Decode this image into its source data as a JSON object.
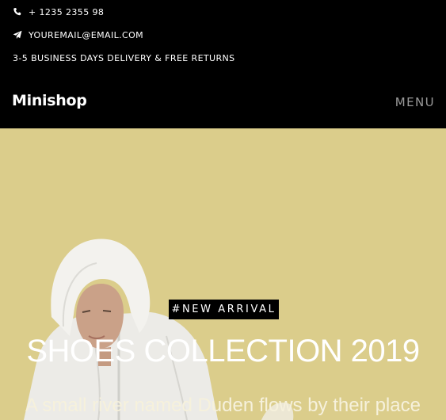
{
  "topbar": {
    "phone": "+ 1235 2355 98",
    "email": "YOUREMAIL@EMAIL.COM",
    "delivery": "3-5 BUSINESS DAYS DELIVERY & FREE RETURNS",
    "icons": {
      "phone": "phone-icon",
      "email": "paper-plane-icon"
    }
  },
  "navbar": {
    "brand": "Minishop",
    "menu_label": "MENU"
  },
  "hero": {
    "badge": "#NEW ARRIVAL",
    "title": "SHOES COLLECTION 2019",
    "subtitle": "A small river named Duden flows by their place",
    "background_color": "#dbcd8b"
  }
}
